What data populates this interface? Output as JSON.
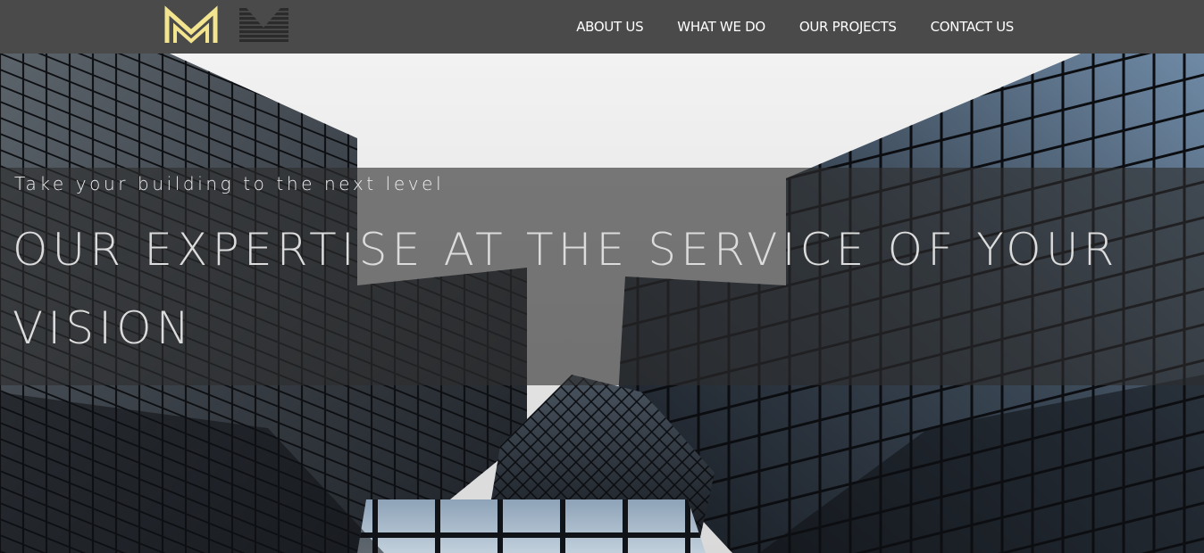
{
  "brand": {
    "logo_icon": "mm-monogram-logo",
    "secondary_logo_icon": "m-stripes-logo",
    "logo_color": "#f3e48f"
  },
  "nav": {
    "items": [
      {
        "label": "ABOUT US"
      },
      {
        "label": "WHAT WE DO"
      },
      {
        "label": "OUR PROJECTS"
      },
      {
        "label": "CONTACT US"
      }
    ]
  },
  "hero": {
    "tagline": "Take your building to the next level",
    "headline": "OUR EXPERTISE AT THE SERVICE OF YOUR VISION",
    "background": "glass-skyscrapers-looking-up"
  },
  "colors": {
    "header_bg": "#4b4a4a",
    "nav_text": "#ffffff",
    "overlay": "rgba(45,45,45,0.62)"
  }
}
